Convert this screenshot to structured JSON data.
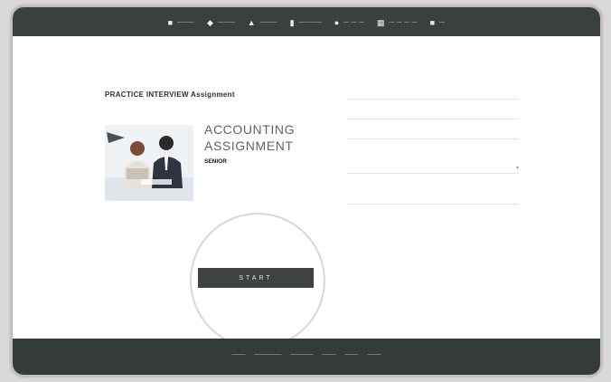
{
  "nav": {
    "items": [
      {
        "icon": "■",
        "label": "———"
      },
      {
        "icon": "◆",
        "label": "———"
      },
      {
        "icon": "▲",
        "label": "———"
      },
      {
        "icon": "▮",
        "label": "————"
      },
      {
        "icon": "●",
        "label": "— — —"
      },
      {
        "icon": "▦",
        "label": "— — — —"
      },
      {
        "icon": "■",
        "label": "—"
      }
    ]
  },
  "assignment": {
    "title": "PRACTICE INTERVIEW Assignment",
    "subtitle": "",
    "caption": "",
    "big_line1": "ACCOUNTING",
    "big_line2": "ASSIGNMENT",
    "line1": "",
    "line2": "",
    "desc_bold": "SENIOR",
    "desc_rest": "",
    "start_button": "START"
  },
  "form": {
    "heading": "",
    "field1_label": "",
    "field2_label": "",
    "field3_label": "",
    "select_label": "",
    "section2_heading": "",
    "field4_label": ""
  },
  "footer": {
    "links": [
      "———",
      "——————",
      "—————",
      "———",
      "———",
      "———"
    ],
    "copyright": ""
  }
}
